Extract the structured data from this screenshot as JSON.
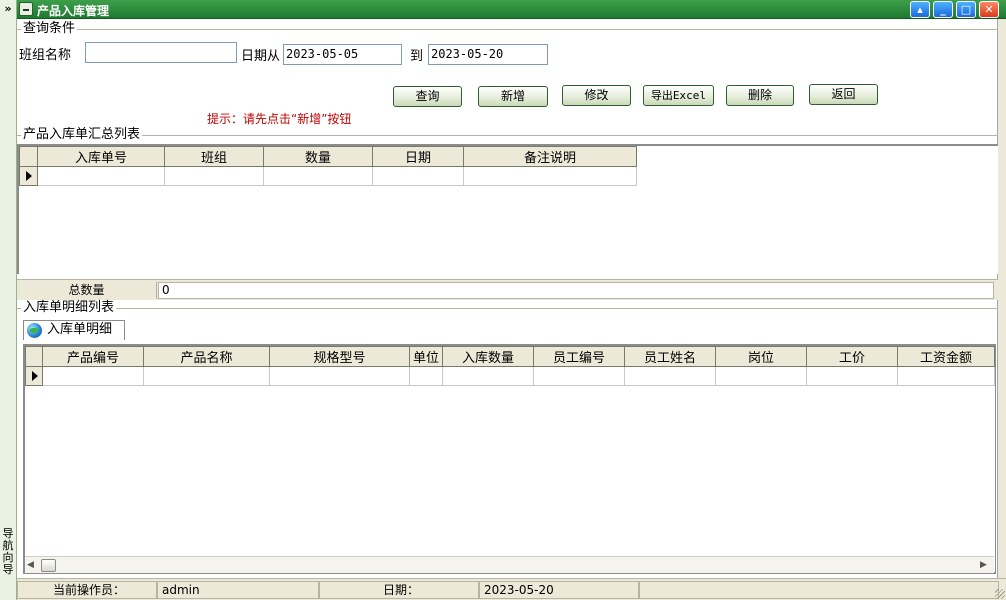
{
  "nav": {
    "toggle": "»",
    "label": "导航向导"
  },
  "window": {
    "title": "产品入库管理"
  },
  "query": {
    "group_title": "查询条件",
    "team_label": "班组名称",
    "team_value": "",
    "date_from_label": "日期从",
    "date_from": "2023-05-05",
    "date_to_label": "到",
    "date_to": "2023-05-20",
    "buttons": {
      "query": "查询",
      "add": "新增",
      "edit": "修改",
      "export": "导出Excel",
      "delete": "删除",
      "back": "返回"
    },
    "hint": "提示：请先点击“新增”按钮"
  },
  "summary": {
    "group_title": "产品入库单汇总列表",
    "columns": [
      "入库单号",
      "班组",
      "数量",
      "日期",
      "备注说明"
    ],
    "total_label": "总数量",
    "total_value": "0"
  },
  "detail": {
    "group_title": "入库单明细列表",
    "tab_label": "入库单明细",
    "columns": [
      "产品编号",
      "产品名称",
      "规格型号",
      "单位",
      "入库数量",
      "员工编号",
      "员工姓名",
      "岗位",
      "工价",
      "工资金额"
    ]
  },
  "status": {
    "operator_label": "当前操作员：",
    "operator": "admin",
    "date_label": "日期：",
    "date": "2023-05-20"
  }
}
